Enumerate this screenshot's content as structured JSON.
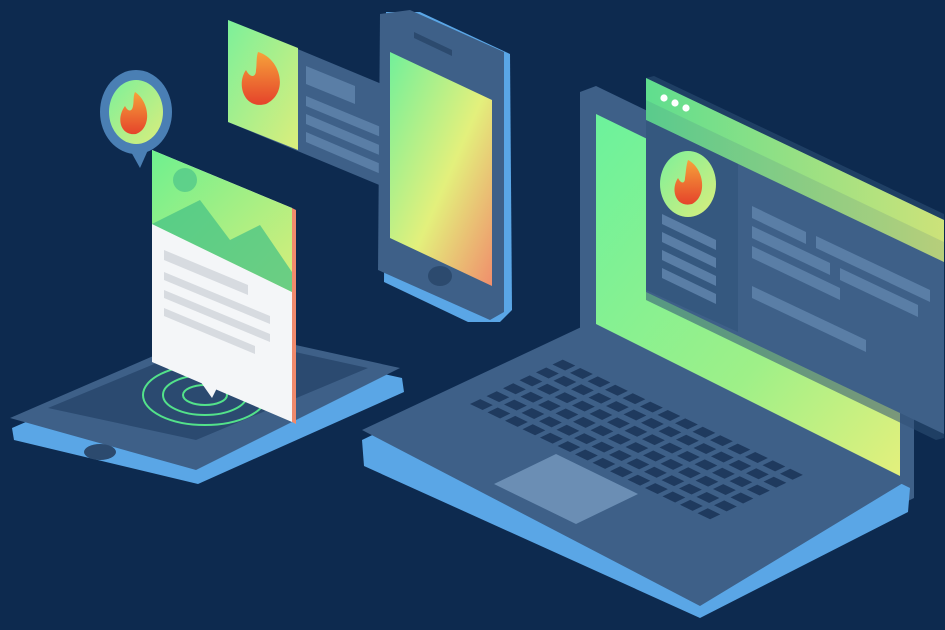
{
  "scene": {
    "background": "#0d2a4f",
    "palette": {
      "device_body": "#3d5f86",
      "device_dark": "#2c4a6e",
      "device_edge": "#5aa6e6",
      "screen_green": "#6ef08f",
      "screen_yellow": "#e8f07a",
      "screen_orange": "#f29a6a",
      "flame_orange": "#f2782a",
      "flame_red": "#e8472d",
      "card_white": "#f4f6f8",
      "radar_green": "#53e28a"
    },
    "illustrations": [
      "tablet-device",
      "notification-card-with-image",
      "chat-bubble-avatar",
      "profile-message-card",
      "smartphone-device",
      "laptop-device",
      "browser-window-with-profile"
    ],
    "icons": [
      "flame-avatar-icon",
      "radar-rings-icon",
      "window-dots-icon",
      "mountain-image-icon"
    ]
  }
}
